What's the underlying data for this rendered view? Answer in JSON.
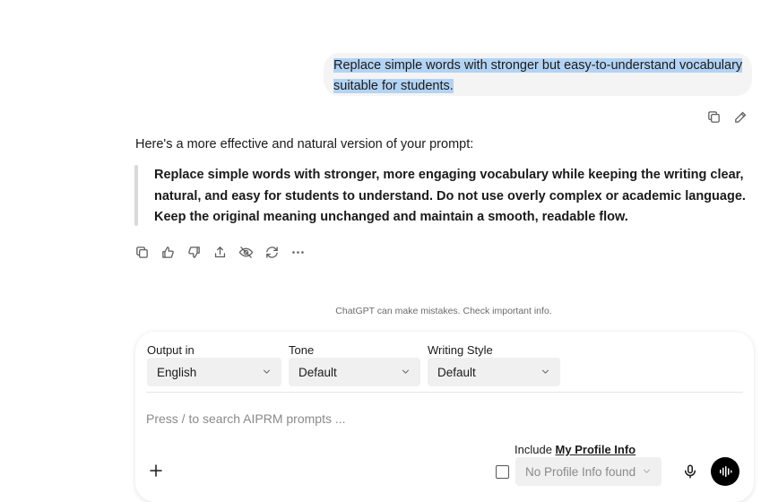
{
  "user_message": {
    "text_line1": "Replace simple words with stronger but easy-to-understand vocabulary",
    "text_line2": "suitable for students."
  },
  "assistant_message": {
    "intro": "Here's a more effective and natural version of your prompt:",
    "quote": "Replace simple words with stronger, more engaging vocabulary while keeping the writing clear, natural, and easy for students to understand. Do not use overly complex or academic language. Keep the original meaning unchanged and maintain a smooth, readable flow."
  },
  "message_actions": [
    "copy-icon",
    "edit-icon"
  ],
  "response_actions": [
    "copy-icon",
    "thumbs-up-icon",
    "thumbs-down-icon",
    "share-icon",
    "hide-icon",
    "regenerate-icon",
    "more-icon"
  ],
  "disclaimer": "ChatGPT can make mistakes. Check important info.",
  "composer": {
    "output_label": "Output in",
    "output_value": "English",
    "tone_label": "Tone",
    "tone_value": "Default",
    "style_label": "Writing Style",
    "style_value": "Default",
    "placeholder": "Press / to search AIPRM prompts ...",
    "include_prefix": "Include ",
    "include_link": "My Profile Info",
    "profile_value": "No Profile Info found",
    "icons": [
      "plus-icon",
      "checkbox",
      "chevron-down-icon",
      "microphone-icon",
      "voice-mode-icon"
    ]
  },
  "colors": {
    "user_bubble": "#f4f4f4",
    "selection": "#b3d3f4",
    "quote_bar": "#d9d9d9",
    "select_bg": "#f0f0f0",
    "voice_button": "#000000"
  }
}
